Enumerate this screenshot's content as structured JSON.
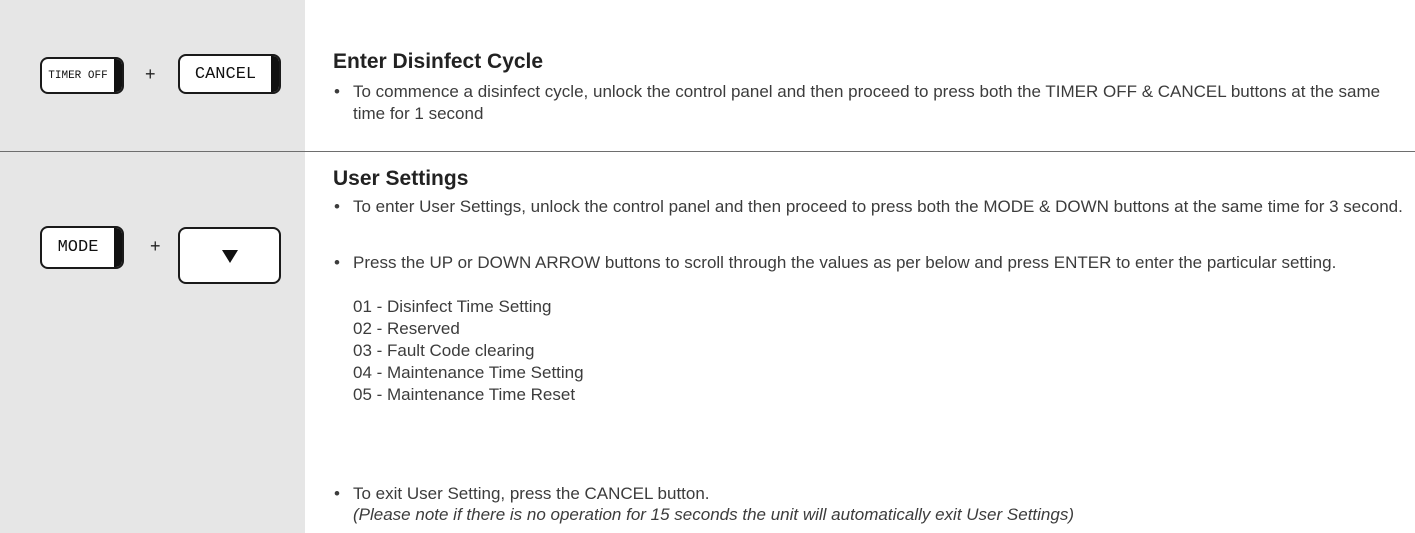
{
  "rows": [
    {
      "keys": {
        "first": "TIMER OFF",
        "plus": "+",
        "second": "CANCEL"
      },
      "title": "Enter Disinfect Cycle",
      "bullets": [
        "To commence a disinfect cycle, unlock the control panel and then proceed to press both the TIMER OFF & CANCEL buttons at the same time for 1 second"
      ]
    },
    {
      "keys": {
        "first": "MODE",
        "plus": "+",
        "second_icon": "down-arrow-icon"
      },
      "title": "User Settings",
      "bullets": [
        "To enter User Settings, unlock the control panel and then proceed to press both the MODE & DOWN buttons at the same time for 3 second.",
        "Press the UP or DOWN ARROW buttons to scroll through the values as per below and press ENTER to enter the particular setting.",
        "To exit User Setting, press the CANCEL button."
      ],
      "settings": [
        "01 - Disinfect Time Setting",
        "02 - Reserved",
        "03 - Fault Code clearing",
        "04 - Maintenance Time Setting",
        "05 - Maintenance Time Reset"
      ],
      "note": "(Please note if there is no operation for 15 seconds the unit will automatically exit User Settings)"
    }
  ],
  "bullet_char": "•"
}
